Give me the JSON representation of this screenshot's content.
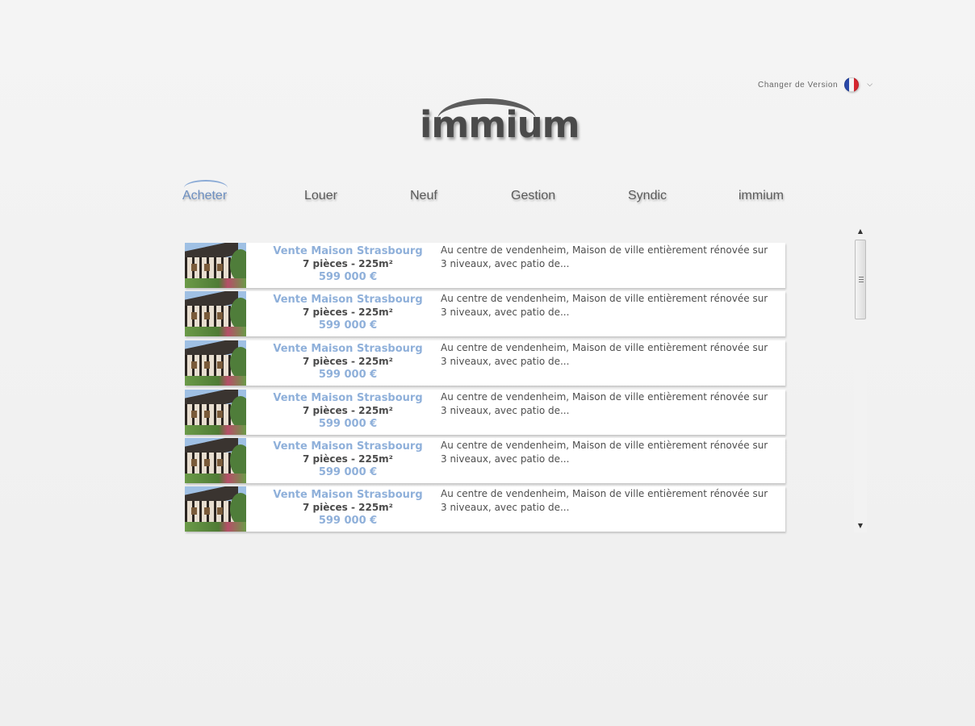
{
  "header": {
    "version_label": "Changer de Version",
    "flag_icon": "french-flag-icon",
    "chevron_icon": "chevron-down-icon"
  },
  "logo": {
    "text": "immium"
  },
  "nav": [
    {
      "label": "Acheter",
      "active": true
    },
    {
      "label": "Louer",
      "active": false
    },
    {
      "label": "Neuf",
      "active": false
    },
    {
      "label": "Gestion",
      "active": false
    },
    {
      "label": "Syndic",
      "active": false
    },
    {
      "label": "immium",
      "active": false
    }
  ],
  "listings": [
    {
      "title": "Vente Maison Strasbourg",
      "details": "7 pièces - 225m²",
      "price": "599 000 €",
      "description": "Au centre de vendenheim, Maison de ville entièrement rénovée sur 3 niveaux, avec patio de..."
    },
    {
      "title": "Vente Maison Strasbourg",
      "details": "7 pièces - 225m²",
      "price": "599 000 €",
      "description": "Au centre de vendenheim, Maison de ville entièrement rénovée sur 3 niveaux, avec patio de..."
    },
    {
      "title": "Vente Maison Strasbourg",
      "details": "7 pièces - 225m²",
      "price": "599 000 €",
      "description": "Au centre de vendenheim, Maison de ville entièrement rénovée sur 3 niveaux, avec patio de..."
    },
    {
      "title": "Vente Maison Strasbourg",
      "details": "7 pièces - 225m²",
      "price": "599 000 €",
      "description": "Au centre de vendenheim, Maison de ville entièrement rénovée sur 3 niveaux, avec patio de..."
    },
    {
      "title": "Vente Maison Strasbourg",
      "details": "7 pièces - 225m²",
      "price": "599 000 €",
      "description": "Au centre de vendenheim, Maison de ville entièrement rénovée sur 3 niveaux, avec patio de..."
    },
    {
      "title": "Vente Maison Strasbourg",
      "details": "7 pièces - 225m²",
      "price": "599 000 €",
      "description": "Au centre de vendenheim, Maison de ville entièrement rénovée sur 3 niveaux, avec patio de..."
    }
  ],
  "scrollbar": {
    "up_icon": "▲",
    "down_icon": "▼"
  },
  "colors": {
    "accent": "#8fb0da",
    "nav_active": "#6d8fc0",
    "text": "#4e4e4e",
    "background": "#f2f2f2"
  }
}
